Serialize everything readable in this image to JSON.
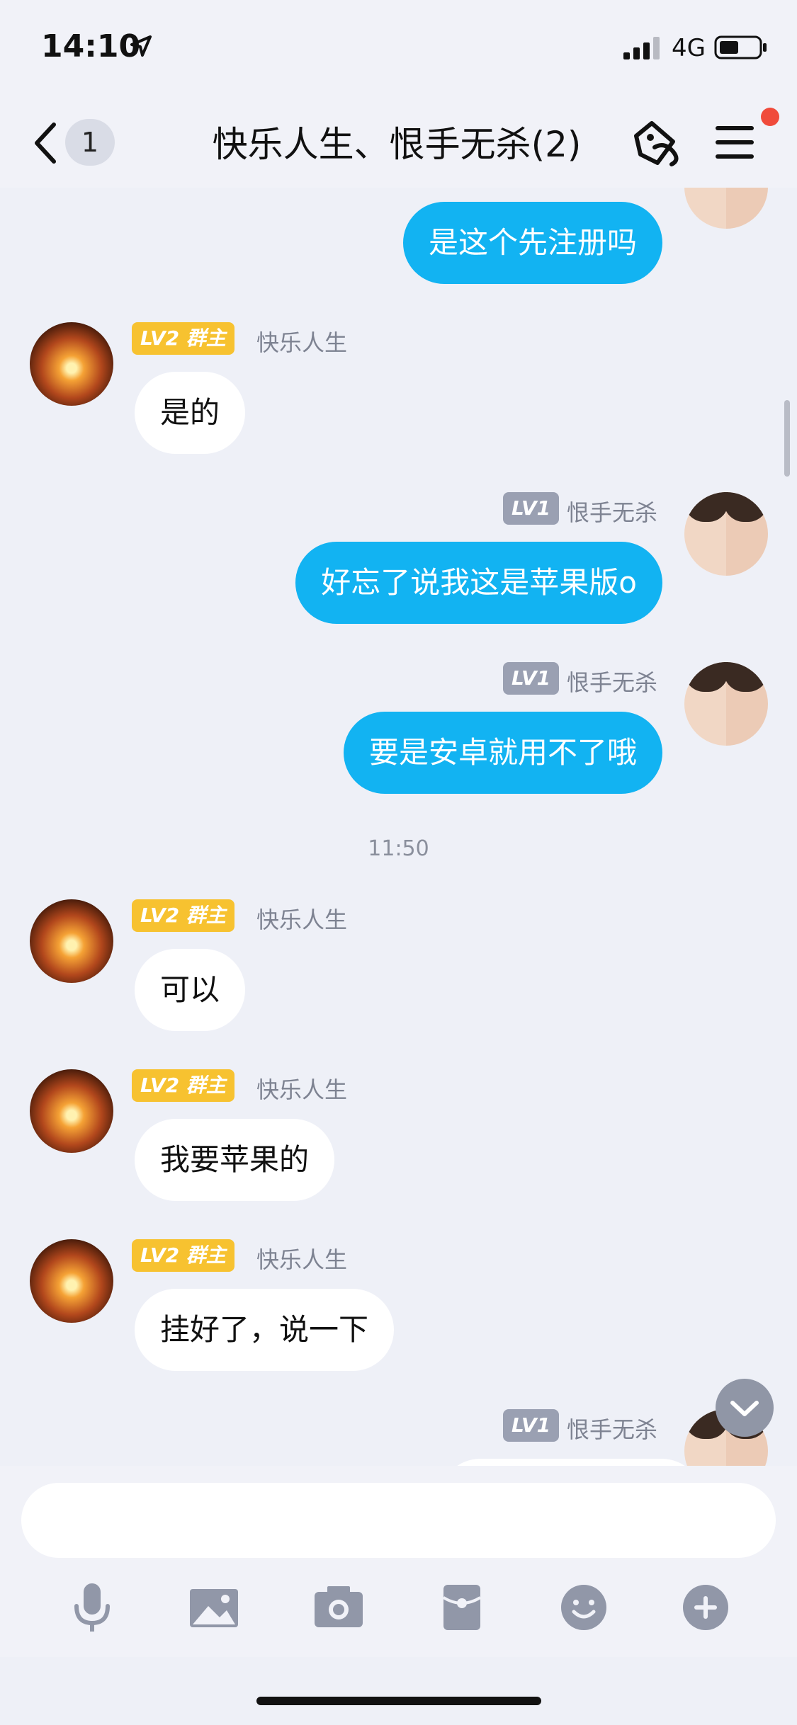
{
  "status": {
    "time": "14:10",
    "network": "4G",
    "icons": [
      "location-arrow-icon",
      "signal-bars-icon",
      "battery-icon"
    ]
  },
  "header": {
    "back_icon": "chevron-left-icon",
    "unread_count": "1",
    "title": "快乐人生、恨手无杀(2)",
    "shop_icon": "tag-icon",
    "menu_icon": "menu-icon",
    "accent_color": "#12b3f2",
    "notification_color": "#f04b3b"
  },
  "chat": {
    "messages": [
      {
        "side": "out",
        "avatar": "girls-avatar",
        "text": "是这个先注册吗"
      },
      {
        "side": "in",
        "avatar": "sunset-avatar",
        "level": "LV2 群主",
        "name": "快乐人生",
        "text": "是的"
      },
      {
        "side": "out",
        "avatar": "girls-avatar",
        "level": "LV1",
        "name": "恨手无杀",
        "text": "好忘了说我这是苹果版o"
      },
      {
        "side": "out",
        "avatar": "girls-avatar",
        "level": "LV1",
        "name": "恨手无杀",
        "text": "要是安卓就用不了哦"
      },
      {
        "side": "in",
        "avatar": "sunset-avatar",
        "level": "LV2 群主",
        "name": "快乐人生",
        "text": "可以"
      },
      {
        "side": "in",
        "avatar": "sunset-avatar",
        "level": "LV2 群主",
        "name": "快乐人生",
        "text": "我要苹果的"
      },
      {
        "side": "in",
        "avatar": "sunset-avatar",
        "level": "LV2 群主",
        "name": "快乐人生",
        "text": "挂好了，说一下"
      },
      {
        "side": "out",
        "avatar": "girls-avatar",
        "level": "LV1",
        "name": "恨手无杀",
        "text": ""
      }
    ],
    "timestamp": "11:50",
    "scroll_down_icon": "chevron-down-icon"
  },
  "composer": {
    "input_value": "",
    "input_placeholder": "",
    "tools": [
      "microphone-icon",
      "image-icon",
      "camera-icon",
      "red-packet-icon",
      "emoji-icon",
      "plus-icon"
    ]
  }
}
